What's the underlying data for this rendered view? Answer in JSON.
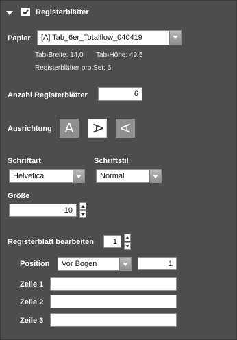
{
  "section": {
    "title": "Registerblätter",
    "enabled": true,
    "icons": {
      "collapse": "chevron-down-icon",
      "checkbox": "checkbox-checked-icon"
    }
  },
  "paper": {
    "label": "Papier",
    "selected": "[A] Tab_6er_Totalflow_040419",
    "tab_width": "Tab-Breite: 14,0",
    "tab_height": "Tab-Höhe: 49,5",
    "tabs_per_set": "Registerblätter pro Set: 6"
  },
  "tab_count": {
    "label": "Anzahl Registerblätter",
    "value": "6"
  },
  "orientation": {
    "label": "Ausrichtung",
    "options": [
      {
        "glyph": "A",
        "name": "normal",
        "active": false
      },
      {
        "glyph": "A",
        "name": "rotate-right",
        "active": true
      },
      {
        "glyph": "A",
        "name": "rotate-left",
        "active": false
      }
    ]
  },
  "font": {
    "label": "Schriftart",
    "selected": "Helvetica"
  },
  "style": {
    "label": "Schriftstil",
    "selected": "Normal"
  },
  "size": {
    "label": "Größe",
    "value": "10"
  },
  "edit_tab": {
    "label": "Registerblatt bearbeiten",
    "value": "1"
  },
  "position": {
    "label": "Position",
    "selected": "Vor Bogen",
    "value": "1"
  },
  "lines": [
    {
      "label": "Zeile 1",
      "value": ""
    },
    {
      "label": "Zeile 2",
      "value": ""
    },
    {
      "label": "Zeile 3",
      "value": ""
    }
  ],
  "colors": {
    "background": "#4d4d4d",
    "field": "#ffffff",
    "inactive_button": "#8f8f8f"
  }
}
